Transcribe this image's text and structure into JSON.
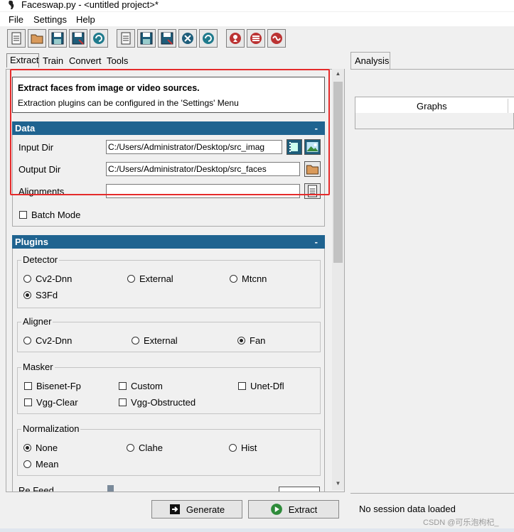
{
  "window": {
    "title": "Faceswap.py - <untitled project>*"
  },
  "menu": {
    "items": [
      "File",
      "Settings",
      "Help"
    ]
  },
  "toolbar": {
    "buttons": [
      "new-project",
      "open-project",
      "save-project",
      "save-project-as",
      "reload-project",
      "new-task",
      "save-task",
      "save-task-as",
      "close-task",
      "reload-task",
      "help",
      "settings",
      "exit"
    ]
  },
  "tabs": [
    "Extract",
    "Train",
    "Convert",
    "Tools"
  ],
  "info": {
    "headline": "Extract faces from image or video sources.",
    "subtext": "Extraction plugins can be configured in the 'Settings' Menu"
  },
  "data_section": {
    "title": "Data",
    "collapse": "-",
    "input_dir_label": "Input Dir",
    "input_dir_value": "C:/Users/Administrator/Desktop/src_imag",
    "output_dir_label": "Output Dir",
    "output_dir_value": "C:/Users/Administrator/Desktop/src_faces",
    "alignments_label": "Alignments",
    "alignments_value": "",
    "batch_mode_label": "Batch Mode"
  },
  "plugins_section": {
    "title": "Plugins",
    "collapse": "-",
    "detector": {
      "label": "Detector",
      "options": [
        "Cv2-Dnn",
        "External",
        "Mtcnn",
        "S3Fd"
      ],
      "selected": "S3Fd"
    },
    "aligner": {
      "label": "Aligner",
      "options": [
        "Cv2-Dnn",
        "External",
        "Fan"
      ],
      "selected": "Fan"
    },
    "masker": {
      "label": "Masker",
      "options": [
        "Bisenet-Fp",
        "Custom",
        "Unet-Dfl",
        "Vgg-Clear",
        "Vgg-Obstructed"
      ]
    },
    "normalization": {
      "label": "Normalization",
      "options": [
        "None",
        "Clahe",
        "Hist",
        "Mean"
      ],
      "selected": "None"
    },
    "partial_label": "Re Feed"
  },
  "actions": {
    "generate": "Generate",
    "extract": "Extract"
  },
  "right": {
    "tab": "Analysis",
    "graphs": "Graphs",
    "status": "No session data loaded"
  },
  "watermark": "CSDN @可乐泡枸杞_",
  "colors": {
    "section_header": "#1f6390",
    "highlight_box": "#e52b2b"
  }
}
